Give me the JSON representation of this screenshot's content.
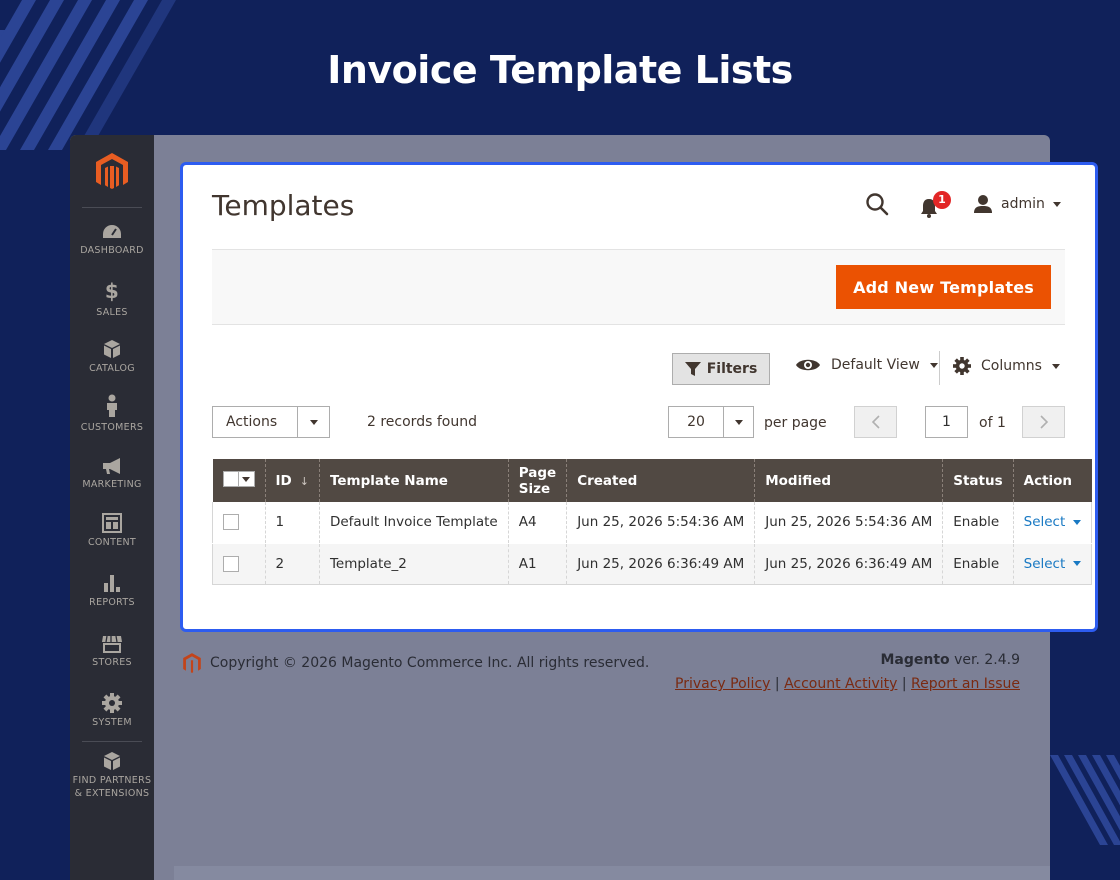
{
  "headline": "Invoice Template Lists",
  "colors": {
    "background": "#10215a",
    "accent": "#eb5202",
    "highlight": "#2d5cf0",
    "grid_header": "#514943",
    "link": "#1979c3"
  },
  "sidebar": {
    "logo": "magento-logo",
    "items": [
      {
        "label": "DASHBOARD",
        "icon": "dashboard-icon"
      },
      {
        "label": "SALES",
        "icon": "dollar-icon"
      },
      {
        "label": "CATALOG",
        "icon": "box-icon"
      },
      {
        "label": "CUSTOMERS",
        "icon": "person-icon"
      },
      {
        "label": "MARKETING",
        "icon": "megaphone-icon"
      },
      {
        "label": "CONTENT",
        "icon": "layout-icon"
      },
      {
        "label": "REPORTS",
        "icon": "bar-chart-icon"
      },
      {
        "label": "STORES",
        "icon": "store-icon"
      },
      {
        "label": "SYSTEM",
        "icon": "gear-icon"
      },
      {
        "label_line1": "FIND PARTNERS",
        "label_line2": "& EXTENSIONS",
        "icon": "cube-icon"
      }
    ]
  },
  "header": {
    "title": "Templates",
    "notification_count": "1",
    "user": "admin"
  },
  "toolbar": {
    "add_button": "Add New Templates",
    "filters": "Filters",
    "view": "Default View",
    "columns": "Columns",
    "actions": "Actions",
    "records": "2 records found",
    "per_page_value": "20",
    "per_page_label": "per page",
    "page_value": "1",
    "page_of": "of 1"
  },
  "grid": {
    "columns": [
      "ID",
      "Template Name",
      "Page Size",
      "Created",
      "Modified",
      "Status",
      "Action"
    ],
    "rows": [
      {
        "id": "1",
        "name": "Default Invoice Template",
        "page_size": "A4",
        "created": "Jun 25, 2026 5:54:36 AM",
        "modified": "Jun 25, 2026 5:54:36 AM",
        "status": "Enable",
        "action": "Select"
      },
      {
        "id": "2",
        "name": "Template_2",
        "page_size": "A1",
        "created": "Jun 25, 2026 6:36:49 AM",
        "modified": "Jun 25, 2026 6:36:49 AM",
        "status": "Enable",
        "action": "Select"
      }
    ]
  },
  "footer": {
    "copyright": "Copyright © 2026 Magento Commerce Inc. All rights reserved.",
    "brand": "Magento",
    "version": " ver. 2.4.9",
    "links": [
      "Privacy Policy",
      "Account Activity",
      "Report an Issue"
    ]
  }
}
